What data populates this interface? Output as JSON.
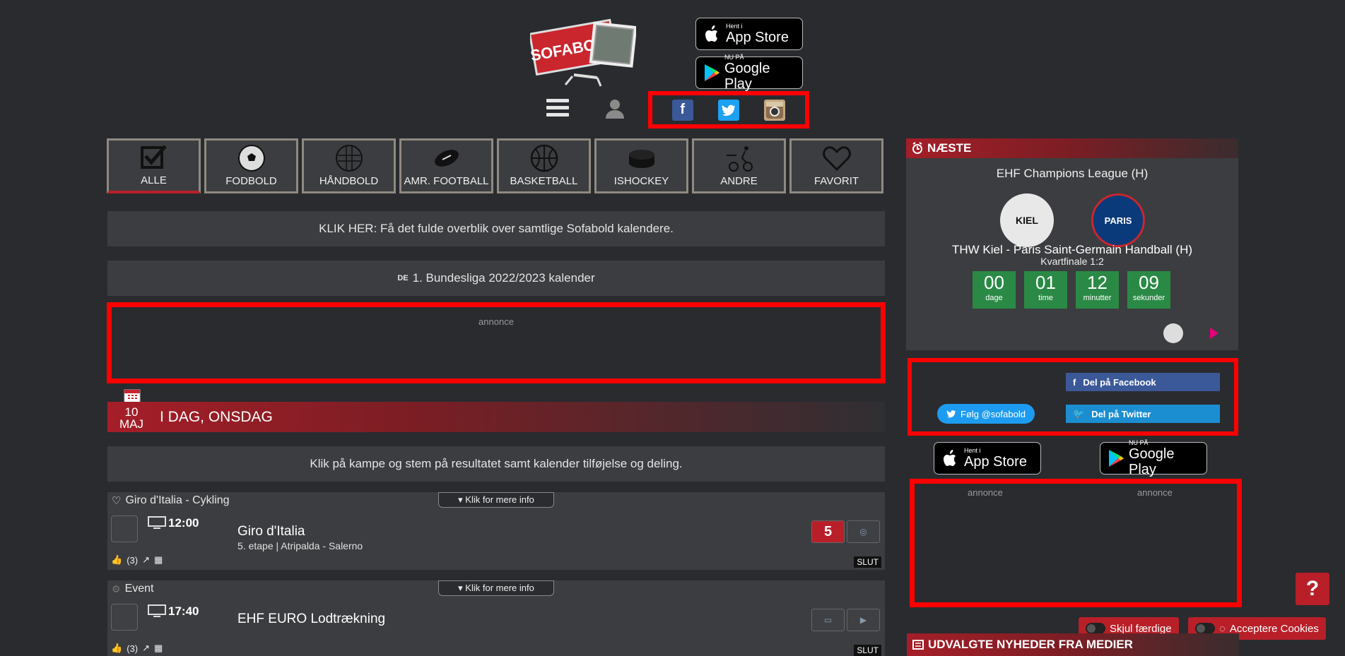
{
  "header": {
    "logo_text": "SOFABOLD",
    "appstore": {
      "small": "Hent i",
      "big": "App Store"
    },
    "googleplay": {
      "small": "NU PÅ",
      "big": "Google Play"
    }
  },
  "tabs": [
    {
      "label": "ALLE",
      "icon": "checkbox-icon"
    },
    {
      "label": "FODBOLD",
      "icon": "football-icon"
    },
    {
      "label": "HÅNDBOLD",
      "icon": "handball-icon"
    },
    {
      "label": "AMR. FOOTBALL",
      "icon": "american-football-icon"
    },
    {
      "label": "BASKETBALL",
      "icon": "basketball-icon"
    },
    {
      "label": "ISHOCKEY",
      "icon": "puck-icon"
    },
    {
      "label": "ANDRE",
      "icon": "other-sports-icon"
    },
    {
      "label": "FAVORIT",
      "icon": "heart-icon"
    }
  ],
  "bars": {
    "calendar_link": "KLIK HER: Få det fulde overblik over samtlige Sofabold kalendere.",
    "league_flag": "DE",
    "league_title": "1. Bundesliga 2022/2023 kalender",
    "ad_label": "annonce",
    "instructions": "Klik på kampe og stem på resultatet samt kalender tilføjelse og deling."
  },
  "day": {
    "date_num": "10",
    "date_month": "MAJ",
    "title": "I DAG, ONSDAG"
  },
  "events": [
    {
      "category": "Giro d'Italia - Cykling",
      "more": "▾ Klik for mere info",
      "time": "12:00",
      "title": "Giro d'Italia",
      "subtitle": "5. etape | Atripalda - Salerno",
      "likes": "(3)",
      "status": "SLUT"
    },
    {
      "category": "Event",
      "more": "▾ Klik for mere info",
      "time": "17:40",
      "title": "EHF EURO Lodtrækning",
      "subtitle": "",
      "likes": "(3)",
      "status": "SLUT"
    }
  ],
  "next": {
    "header": "NÆSTE",
    "league": "EHF Champions League (H)",
    "match": "THW Kiel - Paris Saint-Germain Handball (H)",
    "round": "Kvartfinale 1:2",
    "countdown": [
      {
        "n": "00",
        "u": "dage"
      },
      {
        "n": "01",
        "u": "time"
      },
      {
        "n": "12",
        "u": "minutter"
      },
      {
        "n": "09",
        "u": "sekunder"
      }
    ],
    "home_logo_text": "KIEL",
    "away_logo_text": "PARIS"
  },
  "share": {
    "follow": "Følg @sofabold",
    "facebook": "Del på Facebook",
    "twitter": "Del på Twitter"
  },
  "right_ads": {
    "left": "annonce",
    "right": "annonce"
  },
  "floating": {
    "help": "?",
    "hide_done": "Skjul færdige",
    "accept_cookies": "Acceptere Cookies"
  },
  "news_header": "UDVALGTE NYHEDER FRA MEDIER",
  "colors": {
    "accent": "#b81f28",
    "countdown": "#2a8a45",
    "highlight_border": "#ff0000"
  }
}
